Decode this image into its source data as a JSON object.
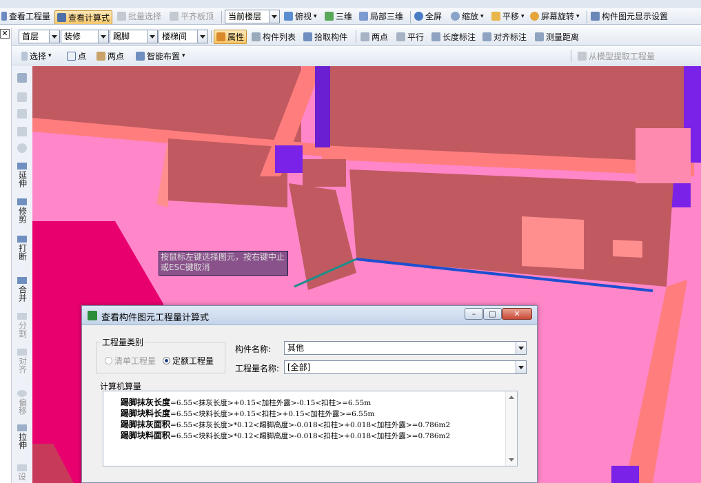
{
  "toolbar1": {
    "view_quantity": "查看工程量",
    "view_formula": "查看计算式",
    "batch_select": "批量选择",
    "align_slab": "平齐板顶",
    "floor_select": "当前楼层",
    "top_view": "俯视",
    "three_d": "三维",
    "local_3d": "局部三维",
    "fullscreen": "全屏",
    "zoom": "缩放",
    "pan": "平移",
    "rotate": "屏幕旋转",
    "display_settings": "构件图元显示设置"
  },
  "toolbar2": {
    "floor": "首层",
    "category": "装修",
    "type": "踢脚",
    "component": "楼梯间",
    "properties": "属性",
    "component_list": "构件列表",
    "pick": "拾取构件",
    "two_point": "两点",
    "parallel": "平行",
    "length_dim": "长度标注",
    "aligned_dim": "对齐标注",
    "measure": "测量距离"
  },
  "toolbar3": {
    "select": "选择",
    "point": "点",
    "two_point": "两点",
    "smart_layout": "智能布置",
    "extract": "从模型提取工程量"
  },
  "vtools": [
    "延伸",
    "修剪",
    "打断",
    "合并",
    "分割",
    "对齐",
    "偏移",
    "拉伸",
    "设"
  ],
  "tooltip": "按鼠标左键选择图元，按右键中止或ESC键取消",
  "dialog": {
    "title": "查看构件图元工程量计算式",
    "qty_type_label": "工程量类别",
    "qty_opt1": "清单工程量",
    "qty_opt2": "定额工程量",
    "comp_name_label": "构件名称:",
    "comp_name_value": "其他",
    "qty_name_label": "工程量名称:",
    "qty_name_value": "[全部]",
    "calc_label": "计算机算量",
    "lines": [
      {
        "name": "踢脚抹灰长度",
        "expr": "=6.55<抹灰长度>+0.15<加柱外露>-0.15<扣柱>=6.55m"
      },
      {
        "name": "踢脚块料长度",
        "expr": "=6.55<块料长度>+0.15<扣柱>+0.15<加柱外露>=6.55m"
      },
      {
        "name": "踢脚抹灰面积",
        "expr": "=6.55<抹灰长度>*0.12<踢脚高度>-0.018<扣柱>+0.018<加柱外露>=0.786m2"
      },
      {
        "name": "踢脚块料面积",
        "expr": "=6.55<块料长度>*0.12<踢脚高度>-0.018<扣柱>+0.018<加柱外露>=0.786m2"
      }
    ]
  }
}
